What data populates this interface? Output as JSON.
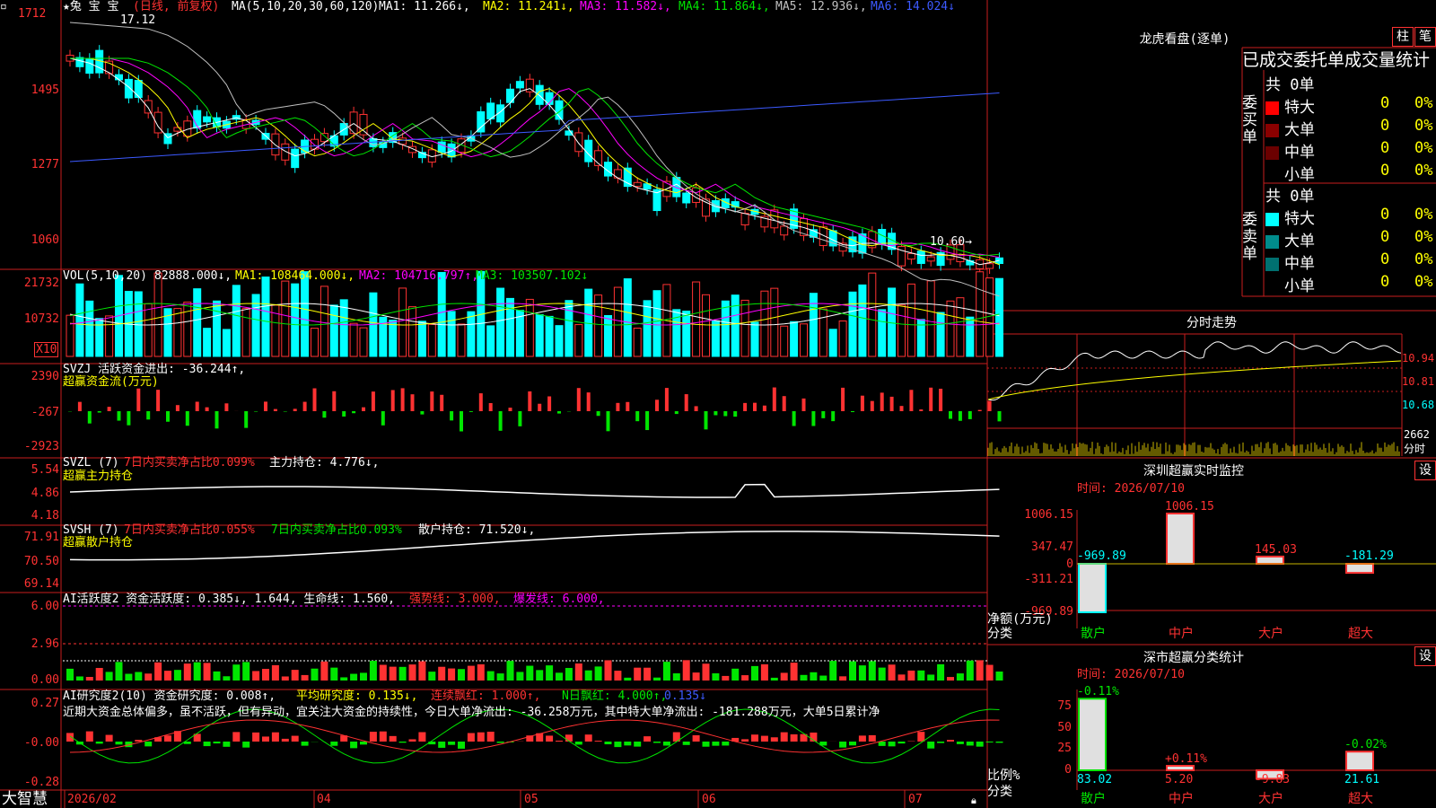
{
  "header": {
    "icon": "square-icon",
    "price_top": "1712",
    "stock_name": "★兔 宝 宝",
    "period": "(日线, 前复权)",
    "ma_spec": "MA(5,10,20,30,60,120)",
    "ma1": "MA1: 11.266↓,",
    "ma2": "MA2: 11.241↓,",
    "ma3": "MA3: 11.582↓,",
    "ma4": "MA4: 11.864↓,",
    "ma5": "MA5: 12.936↓,",
    "ma6": "MA6: 14.024↓",
    "high_label": "17.12",
    "low_label": "10.60→"
  },
  "price_axis": [
    "1712",
    "1495",
    "1277",
    "1060"
  ],
  "vol": {
    "axis": [
      "21732",
      "10732"
    ],
    "unit": "X10",
    "spec": "VOL(5,10,20)",
    "value": "82888.000↓,",
    "ma1": "MA1: 108464.000↓,",
    "ma2": "MA2: 104716.797↑,",
    "ma3": "MA3: 103507.102↓"
  },
  "svzj": {
    "axis": [
      "2390",
      "-267",
      "-2923"
    ],
    "line1": "SVZJ  活跃资金进出: -36.244↑,",
    "line2": "超赢资金流(万元)"
  },
  "svzl": {
    "axis": [
      "5.54",
      "4.86",
      "4.18"
    ],
    "prefix": "SVZL (7)",
    "ratio": "7日内买卖净占比0.099%",
    "hold": "主力持仓: 4.776↓,",
    "line2": "超赢主力持仓"
  },
  "svsh": {
    "axis": [
      "71.91",
      "70.50",
      "69.14"
    ],
    "prefix": "SVSH (7)",
    "ratio1": "7日内买卖净占比0.055%",
    "ratio2": "7日内买卖净占比0.093%",
    "hold": "散户持仓: 71.520↓,",
    "line2": "超赢散户持仓"
  },
  "ai1": {
    "axis": [
      "6.00",
      "2.96",
      "0.00"
    ],
    "text": "AI活跃度2 资金活跃度: 0.385↓, 1.644, 生命线: 1.560,",
    "strong": "强势线: 3.000,",
    "burst": "爆发线: 6.000,"
  },
  "ai2": {
    "axis": [
      "0.27",
      "-0.00",
      "-0.28"
    ],
    "title": "AI研究度2(10) 资金研究度: 0.008↑,",
    "avg": "平均研究度: 0.135↓,",
    "streak": "连续飘红: 1.000↑,",
    "nday": "N日飘红: 4.000↑,",
    "last": "0.135↓",
    "comment": "近期大资金总体偏多，虽不活跃，但有异动，宜关注大资金的持续性，今日大单净流出: -36.258万元，其中特大单净流出: -181.288万元，大单5日累计净"
  },
  "footer": {
    "brand": "大智慧",
    "dates": [
      "2026/02",
      "04",
      "05",
      "06",
      "07"
    ]
  },
  "longhu": {
    "title": "龙虎看盘(逐单)",
    "btn1": "柱",
    "btn2": "笔",
    "header": "已成交委托单成交量统计",
    "buy_side": "委买单",
    "sell_side": "委卖单",
    "buy_total": "共 0单",
    "sell_total": "共 0单",
    "buy_rows": [
      {
        "label": "特大",
        "count": "0",
        "pct": "0%",
        "color": "#ff0000"
      },
      {
        "label": "大单",
        "count": "0",
        "pct": "0%",
        "color": "#8b0000"
      },
      {
        "label": "中单",
        "count": "0",
        "pct": "0%",
        "color": "#6b0000"
      },
      {
        "label": "小单",
        "count": "0",
        "pct": "0%",
        "color": "#000000"
      }
    ],
    "sell_rows": [
      {
        "label": "特大",
        "count": "0",
        "pct": "0%",
        "color": "#00ffff"
      },
      {
        "label": "大单",
        "count": "0",
        "pct": "0%",
        "color": "#008b8b"
      },
      {
        "label": "中单",
        "count": "0",
        "pct": "0%",
        "color": "#007070"
      },
      {
        "label": "小单",
        "count": "0",
        "pct": "0%",
        "color": "#000000"
      }
    ]
  },
  "intraday": {
    "title": "分时走势",
    "axis": [
      "10.94",
      "10.81",
      "10.68"
    ],
    "vol_top": "2662",
    "vol_unit": "分时"
  },
  "monitor": {
    "title": "深圳超赢实时监控",
    "btn": "设",
    "time": "时间: 2026/07/10",
    "axis": [
      "1006.15",
      "347.47",
      "0",
      "-311.21",
      "-969.89"
    ],
    "net_label": "净额(万元)",
    "cat_label": "分类",
    "categories": [
      "散户",
      "中户",
      "大户",
      "超大"
    ],
    "values": [
      "-969.89",
      "1006.15",
      "145.03",
      "-181.29"
    ]
  },
  "classify": {
    "title": "深市超赢分类统计",
    "btn": "设",
    "time": "时间: 2026/07/10",
    "axis": [
      "75",
      "50",
      "25",
      "0"
    ],
    "ratio_label": "比例%",
    "cat_label": "分类",
    "categories": [
      "散户",
      "中户",
      "大户",
      "超大"
    ],
    "values": [
      "83.02",
      "5.20",
      "-9.83",
      "21.61"
    ],
    "changes": [
      "-0.11%",
      "+0.11%",
      "",
      "-0.02%"
    ]
  },
  "chart_data": {
    "type": "candlestick",
    "ylim": [
      10.6,
      17.12
    ],
    "xlabels": [
      "2026/02",
      "04",
      "05",
      "06",
      "07"
    ],
    "ma_colors": {
      "ma1": "#ffffff",
      "ma2": "#ffff00",
      "ma3": "#ff00ff",
      "ma4": "#00e600",
      "ma5": "#c0c0c0",
      "ma6": "#3c5aff"
    }
  }
}
